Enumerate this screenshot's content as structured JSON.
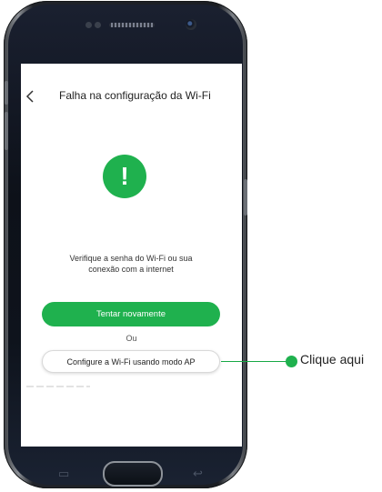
{
  "screen": {
    "title": "Falha na configuração da Wi-Fi",
    "status_icon": "exclamation-icon",
    "status_glyph": "!",
    "message_line1": "Verifique a senha do Wi-Fi ou sua",
    "message_line2": "conexão com a internet",
    "retry_label": "Tentar novamente",
    "or_label": "Ou",
    "ap_label": "Configure a Wi-Fi usando modo AP"
  },
  "callout": {
    "label": "Clique aqui"
  },
  "colors": {
    "accent": "#1fb14e"
  }
}
